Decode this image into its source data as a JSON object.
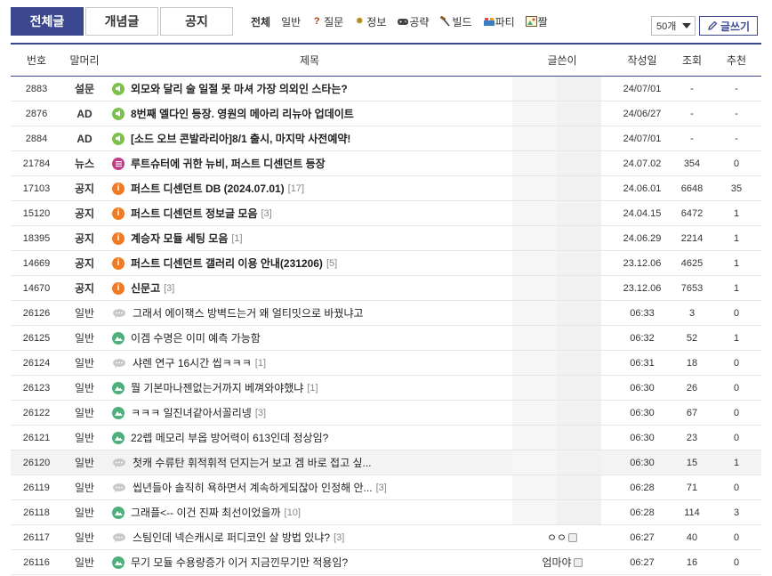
{
  "tabs": [
    {
      "label": "전체글",
      "active": true
    },
    {
      "label": "개념글",
      "active": false
    },
    {
      "label": "공지",
      "active": false
    }
  ],
  "categories": [
    {
      "label": "전체",
      "icon": "",
      "active": true
    },
    {
      "label": "일반",
      "icon": "",
      "active": false
    },
    {
      "label": "질문",
      "icon": "question-icon",
      "active": false
    },
    {
      "label": "정보",
      "icon": "gear-icon",
      "active": false
    },
    {
      "label": "공략",
      "icon": "gamepad-icon",
      "active": false
    },
    {
      "label": "빌드",
      "icon": "hammer-icon",
      "active": false
    },
    {
      "label": "파티",
      "icon": "party-icon",
      "active": false
    },
    {
      "label": "짤",
      "icon": "picture-icon",
      "active": false
    }
  ],
  "perpage": "50개",
  "write_label": "글쓰기",
  "columns": {
    "num": "번호",
    "head": "말머리",
    "title": "제목",
    "writer": "글쓴이",
    "date": "작성일",
    "views": "조회",
    "rec": "추천"
  },
  "colors": {
    "accent": "#3b4890",
    "speaker": "#7cc14a",
    "news": "#c23b8a",
    "info": "#f07b22",
    "image": "#4caf7c",
    "chat": "#c8c8c8"
  },
  "rows": [
    {
      "num": "2883",
      "head": "설문",
      "icon": "speaker-icon",
      "title": "외모와 달리 술 일절 못 마셔 가장 의외인 스타는?",
      "count": "",
      "writer": "",
      "date": "24/07/01",
      "views": "-",
      "rec": "-",
      "bold": true
    },
    {
      "num": "2876",
      "head": "AD",
      "icon": "speaker-icon",
      "title": "8번째 엘다인 등장. 영원의 메아리 리뉴아 업데이트",
      "count": "",
      "writer": "",
      "date": "24/06/27",
      "views": "-",
      "rec": "-",
      "bold": true
    },
    {
      "num": "2884",
      "head": "AD",
      "icon": "speaker-icon",
      "title": "[소드 오브 콘발라리아]8/1 출시, 마지막 사전예약!",
      "count": "",
      "writer": "",
      "date": "24/07/01",
      "views": "-",
      "rec": "-",
      "bold": true
    },
    {
      "num": "21784",
      "head": "뉴스",
      "icon": "news-icon",
      "title": "루트슈터에 귀한 뉴비, 퍼스트 디센던트 등장",
      "count": "",
      "writer": "",
      "date": "24.07.02",
      "views": "354",
      "rec": "0",
      "bold": true
    },
    {
      "num": "17103",
      "head": "공지",
      "icon": "info-icon",
      "title": "퍼스트 디센던트 DB (2024.07.01)",
      "count": "[17]",
      "writer": "",
      "date": "24.06.01",
      "views": "6648",
      "rec": "35",
      "bold": true
    },
    {
      "num": "15120",
      "head": "공지",
      "icon": "info-icon",
      "title": "퍼스트 디센던트 정보글 모음",
      "count": "[3]",
      "writer": "",
      "date": "24.04.15",
      "views": "6472",
      "rec": "1",
      "bold": true
    },
    {
      "num": "18395",
      "head": "공지",
      "icon": "info-icon",
      "title": "계승자 모듈 세팅 모음",
      "count": "[1]",
      "writer": "",
      "date": "24.06.29",
      "views": "2214",
      "rec": "1",
      "bold": true
    },
    {
      "num": "14669",
      "head": "공지",
      "icon": "info-icon",
      "title": "퍼스트 디센던트 갤러리 이용 안내(231206)",
      "count": "[5]",
      "writer": "",
      "date": "23.12.06",
      "views": "4625",
      "rec": "1",
      "bold": true
    },
    {
      "num": "14670",
      "head": "공지",
      "icon": "info-icon",
      "title": "신문고",
      "count": "[3]",
      "writer": "",
      "date": "23.12.06",
      "views": "7653",
      "rec": "1",
      "bold": true
    },
    {
      "num": "26126",
      "head": "일반",
      "icon": "chat-icon",
      "title": "그래서 에이잭스 방벽드는거 왜 얼티밋으로 바꿨냐고",
      "count": "",
      "writer": "",
      "date": "06:33",
      "views": "3",
      "rec": "0",
      "bold": false
    },
    {
      "num": "26125",
      "head": "일반",
      "icon": "image-icon",
      "title": "이겜 수명은 이미 예측 가능함",
      "count": "",
      "writer": "",
      "date": "06:32",
      "views": "52",
      "rec": "1",
      "bold": false
    },
    {
      "num": "26124",
      "head": "일반",
      "icon": "chat-icon",
      "title": "샤렌 연구 16시간 씹ㅋㅋㅋ",
      "count": "[1]",
      "writer": "",
      "date": "06:31",
      "views": "18",
      "rec": "0",
      "bold": false
    },
    {
      "num": "26123",
      "head": "일반",
      "icon": "image-icon",
      "title": "뭘 기본마나젠없는거까지 베껴와야했냐",
      "count": "[1]",
      "writer": "",
      "date": "06:30",
      "views": "26",
      "rec": "0",
      "bold": false
    },
    {
      "num": "26122",
      "head": "일반",
      "icon": "image-icon",
      "title": "ㅋㅋㅋ 일진녀같아서꼴리넹",
      "count": "[3]",
      "writer": "",
      "date": "06:30",
      "views": "67",
      "rec": "0",
      "bold": false
    },
    {
      "num": "26121",
      "head": "일반",
      "icon": "image-icon",
      "title": "22렙 메모리 부옵 방어력이 613인데 정상임?",
      "count": "",
      "writer": "",
      "date": "06:30",
      "views": "23",
      "rec": "0",
      "bold": false
    },
    {
      "num": "26120",
      "head": "일반",
      "icon": "chat-icon",
      "title": "첫캐 수류탄 휘적휘적 던지는거 보고 겜 바로 접고 싶...",
      "count": "",
      "writer": "",
      "date": "06:30",
      "views": "15",
      "rec": "1",
      "bold": false,
      "highlight": true
    },
    {
      "num": "26119",
      "head": "일반",
      "icon": "chat-icon",
      "title": "씹년들아 솔직히 욕하면서 계속하게되잖아 인정해 안...",
      "count": "[3]",
      "writer": "",
      "date": "06:28",
      "views": "71",
      "rec": "0",
      "bold": false
    },
    {
      "num": "26118",
      "head": "일반",
      "icon": "image-icon",
      "title": "그래플<-- 이건 진짜 최선이었을까",
      "count": "[10]",
      "writer": "",
      "date": "06:28",
      "views": "114",
      "rec": "3",
      "bold": false
    },
    {
      "num": "26117",
      "head": "일반",
      "icon": "chat-icon",
      "title": "스팀인데 넥슨캐시로 퍼디코인 살 방법 있냐?",
      "count": "[3]",
      "writer": "ㅇㅇ",
      "date": "06:27",
      "views": "40",
      "rec": "0",
      "bold": false
    },
    {
      "num": "26116",
      "head": "일반",
      "icon": "image-icon",
      "title": "무기 모듈 수용량증가 이거 지금낀무기만 적용임?",
      "count": "",
      "writer": "엄마야",
      "date": "06:27",
      "views": "16",
      "rec": "0",
      "bold": false
    }
  ]
}
